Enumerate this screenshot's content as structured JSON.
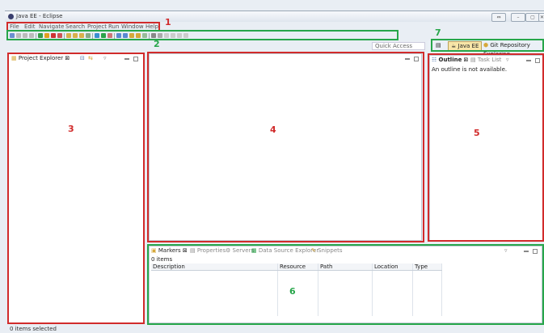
{
  "window": {
    "title": "Java EE - Eclipse"
  },
  "menu": [
    "File",
    "Edit",
    "Navigate",
    "Search",
    "Project",
    "Run",
    "Window",
    "Help"
  ],
  "quick_access": {
    "placeholder": "Quick Access"
  },
  "perspectives": {
    "java_ee": "Java EE",
    "git": "Git Repository Exploring"
  },
  "project_explorer": {
    "tab": "Project Explorer"
  },
  "outline": {
    "tab": "Outline",
    "task_tab": "Task List",
    "message": "An outline is not available."
  },
  "bottom": {
    "tabs": [
      "Markers",
      "Properties",
      "Servers",
      "Data Source Explorer",
      "Snippets"
    ],
    "count": "0 items",
    "columns": [
      "Description",
      "Resource",
      "Path",
      "Location",
      "Type"
    ]
  },
  "status": {
    "text": "0 items selected"
  },
  "annotations": {
    "n1": "1",
    "n2": "2",
    "n3": "3",
    "n4": "4",
    "n5": "5",
    "n6": "6",
    "n7": "7"
  },
  "colors": {
    "annotation_red": "#d12b2b",
    "annotation_green": "#27a64a"
  }
}
